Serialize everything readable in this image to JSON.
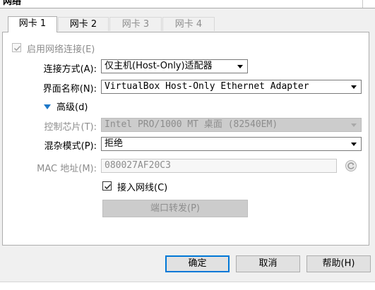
{
  "header": {
    "title": "网络"
  },
  "tabs": [
    {
      "label": "网卡 1",
      "state": "active"
    },
    {
      "label": "网卡 2",
      "state": "inactive"
    },
    {
      "label": "网卡 3",
      "state": "disabled"
    },
    {
      "label": "网卡 4",
      "state": "disabled"
    }
  ],
  "adapter": {
    "enable_label": "启用网络连接(E)",
    "enable_checked": true,
    "attached_label": "连接方式(A):",
    "attached_value": "仅主机(Host-Only)适配器",
    "name_label": "界面名称(N):",
    "name_value": "VirtualBox Host-Only Ethernet Adapter",
    "advanced_label": "高级(d)",
    "chip_label": "控制芯片(T):",
    "chip_value": "Intel PRO/1000 MT 桌面 (82540EM)",
    "promisc_label": "混杂模式(P):",
    "promisc_value": "拒绝",
    "mac_label": "MAC 地址(M):",
    "mac_value": "080027AF20C3",
    "cable_label": "接入网线(C)",
    "cable_checked": true,
    "port_forward_label": "端口转发(P)"
  },
  "buttons": {
    "ok": "确定",
    "cancel": "取消",
    "help": "帮助(H)"
  },
  "icons": {
    "refresh_mac": "refresh-icon",
    "advanced_toggle": "triangle-down-icon",
    "check": "checkmark-icon"
  },
  "colors": {
    "accent": "#0078d7",
    "disabled_text": "#8d8d8d",
    "panel_bg": "#ffffff",
    "window_bg": "#f0f0f0"
  }
}
